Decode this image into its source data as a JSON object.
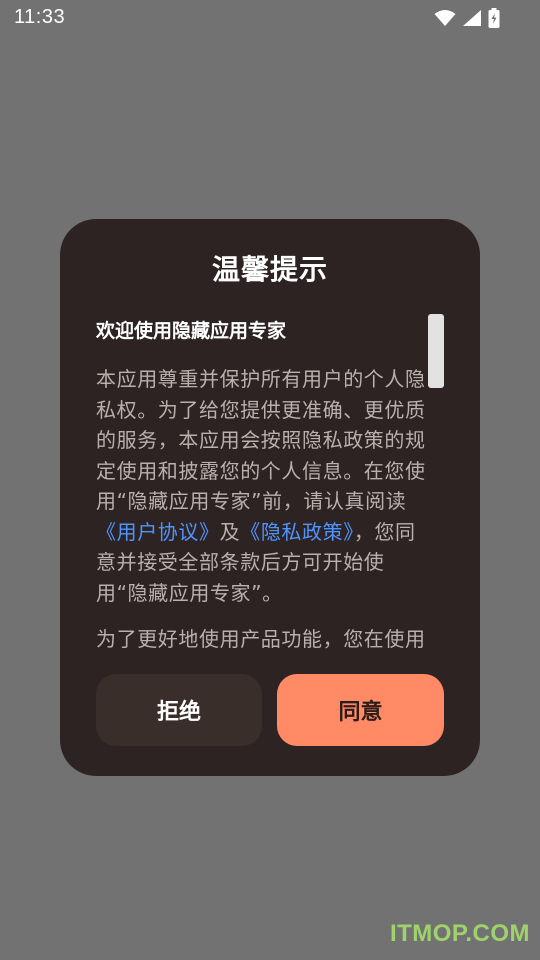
{
  "status_bar": {
    "time": "11:33",
    "icons": [
      "wifi-icon",
      "signal-icon",
      "battery-charging-icon"
    ]
  },
  "dialog": {
    "title": "温馨提示",
    "heading": "欢迎使用隐藏应用专家",
    "paragraph_before_links": "本应用尊重并保护所有用户的个人隐私权。为了给您提供更准确、更优质的服务，本应用会按照隐私政策的规定使用和披露您的个人信息。在您使用“隐藏应用专家”前，请认真阅读",
    "user_agreement_link": "《用户协议》",
    "and_text": "及",
    "privacy_policy_link": "《隐私政策》",
    "paragraph_after_links": "，您同意并接受全部条款后方可开始使用“隐藏应用专家”。",
    "paragraph_2_partial": "为了更好地使用产品功能，您在使用",
    "reject_button": "拒绝",
    "agree_button": "同意"
  },
  "watermark": "ITMOP.COM",
  "colors": {
    "backdrop": "#727272",
    "dialog_bg": "#2c2322",
    "link": "#4f95ff",
    "agree_bg": "#ff8a65",
    "reject_bg": "#3a2e2b"
  }
}
